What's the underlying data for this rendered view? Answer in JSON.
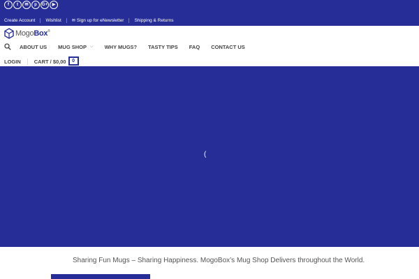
{
  "topbar": {
    "social_icons": [
      "facebook-icon",
      "twitter-icon",
      "email-icon",
      "pinterest-icon",
      "google-plus-icon",
      "youtube-icon"
    ],
    "links": [
      "Create Account",
      "Wishlist",
      "Sign up for eNewsletter",
      "Shipping & Returns"
    ]
  },
  "header": {
    "logo_text_light": "Mogo",
    "logo_text_bold": "Box",
    "nav": [
      "ABOUT US",
      "MUG SHOP",
      "WHY MUGS?",
      "TASTY TIPS",
      "FAQ",
      "CONTACT US"
    ],
    "login": "LOGIN",
    "cart": "CART / $0,00",
    "cart_count": "0"
  },
  "hero": {
    "loader_glyph": "("
  },
  "tagline": "Sharing Fun Mugs – Sharing Happiness.  MogoBox’s Mug Shop Delivers throughout the World.",
  "colors": {
    "brand": "#262d97"
  }
}
